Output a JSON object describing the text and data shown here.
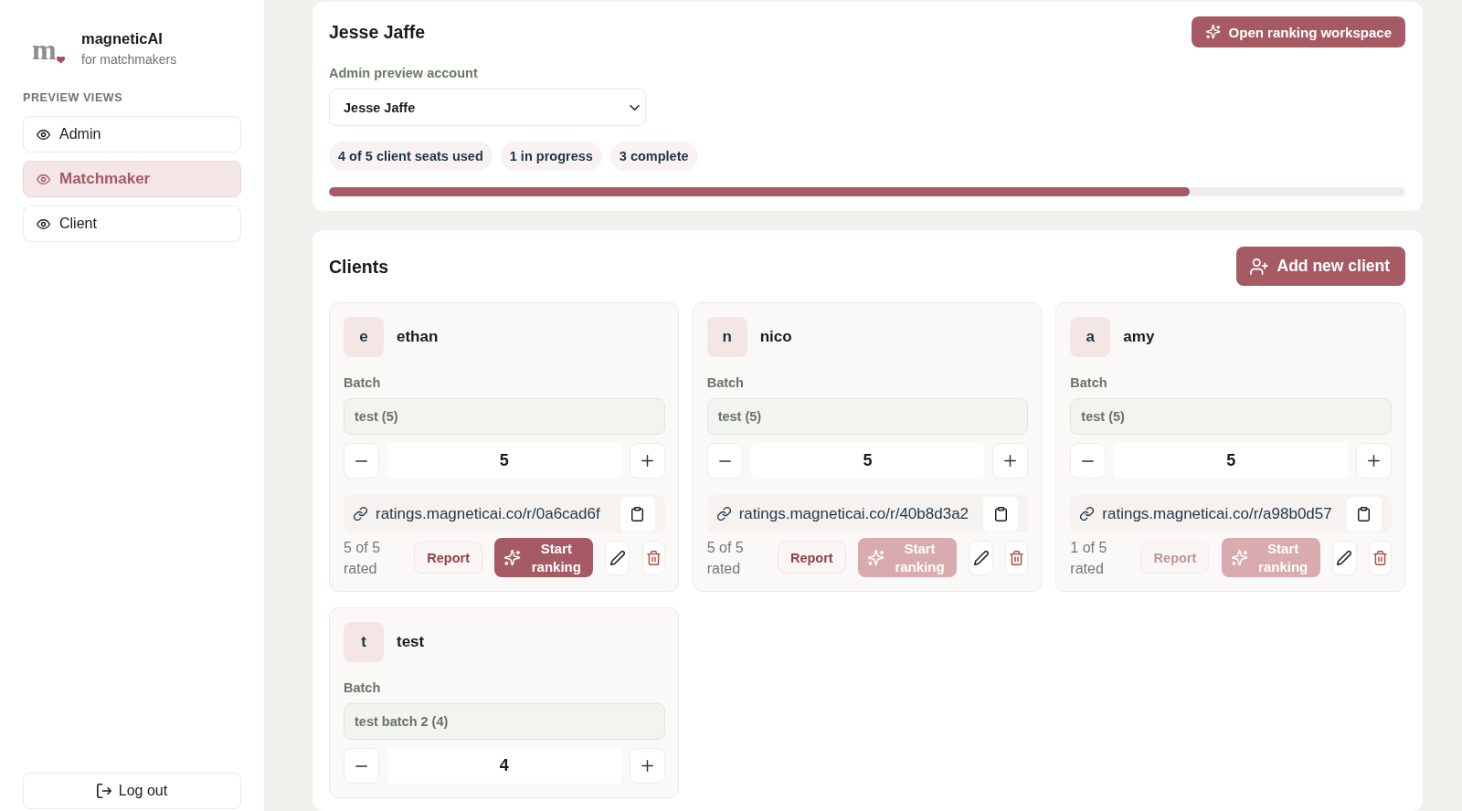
{
  "sidebar": {
    "brand": {
      "logo_letter": "m",
      "name": "magneticAI",
      "tagline": "for matchmakers"
    },
    "section_title": "PREVIEW VIEWS",
    "items": [
      {
        "label": "Admin",
        "selected": false
      },
      {
        "label": "Matchmaker",
        "selected": true
      },
      {
        "label": "Client",
        "selected": false
      }
    ],
    "logout_label": "Log out"
  },
  "account": {
    "title": "Jesse Jaffe",
    "action_button": "Open ranking workspace",
    "field_label": "Admin preview account",
    "select_value": "Jesse Jaffe",
    "stats": [
      "4 of 5 client seats used",
      "1 in progress",
      "3 complete"
    ],
    "progress": {
      "level": 0.8
    }
  },
  "clients": {
    "title": "Clients",
    "add_button": "Add new client",
    "cards": [
      {
        "initial": "e",
        "name": "ethan",
        "batch_label": "Batch",
        "batch": "test (5)",
        "count": "5",
        "link": "ratings.magneticai.co/r/0a6cad6f",
        "rated": "5 of 5 rated",
        "report": {
          "label": "Report",
          "disabled": false
        },
        "start": {
          "label": "Start ranking",
          "disabled": false
        }
      },
      {
        "initial": "n",
        "name": "nico",
        "batch_label": "Batch",
        "batch": "test (5)",
        "count": "5",
        "link": "ratings.magneticai.co/r/40b8d3a2",
        "rated": "5 of 5 rated",
        "report": {
          "label": "Report",
          "disabled": false
        },
        "start": {
          "label": "Start ranking",
          "disabled": true
        }
      },
      {
        "initial": "a",
        "name": "amy",
        "batch_label": "Batch",
        "batch": "test (5)",
        "count": "5",
        "link": "ratings.magneticai.co/r/a98b0d57",
        "rated": "1 of 5 rated",
        "report": {
          "label": "Report",
          "disabled": true
        },
        "start": {
          "label": "Start ranking",
          "disabled": true
        }
      },
      {
        "initial": "t",
        "name": "test",
        "batch_label": "Batch",
        "batch": "test batch 2 (4)",
        "count": "4"
      }
    ]
  }
}
